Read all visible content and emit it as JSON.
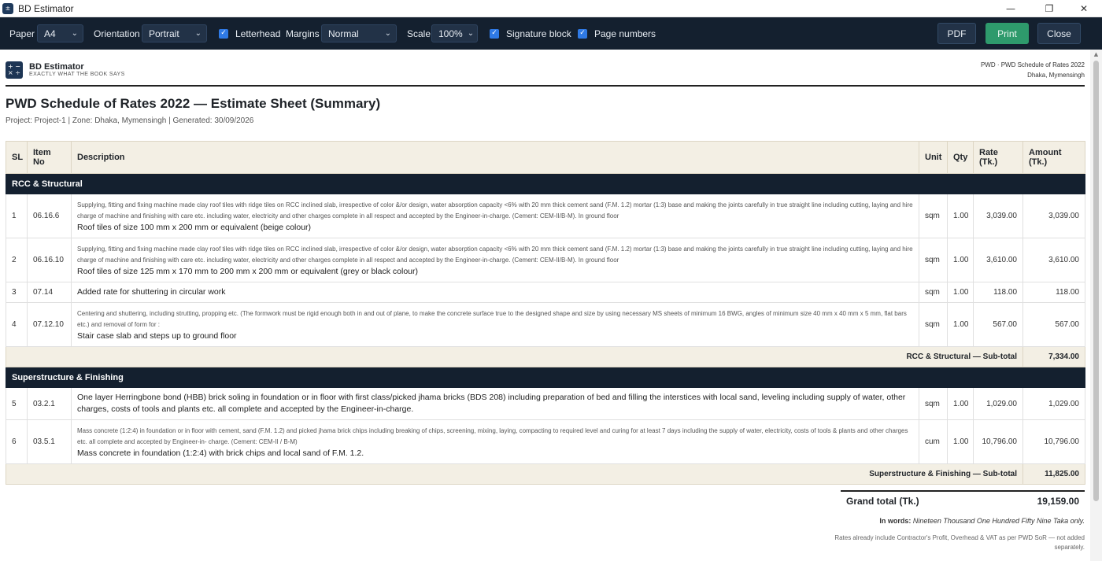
{
  "window": {
    "title": "BD Estimator",
    "controls": {
      "minimize": "—",
      "maximize": "❐",
      "close": "✕"
    }
  },
  "toolbar": {
    "paper_label": "Paper",
    "paper_value": "A4",
    "orientation_label": "Orientation",
    "orientation_value": "Portrait",
    "letterhead_label": "Letterhead",
    "letterhead_checked": true,
    "margins_label": "Margins",
    "margins_value": "Normal",
    "scale_label": "Scale",
    "scale_value": "100%",
    "signature_label": "Signature block",
    "signature_checked": true,
    "page_numbers_label": "Page numbers",
    "page_numbers_checked": true,
    "pdf_label": "PDF",
    "print_label": "Print",
    "close_label": "Close"
  },
  "header": {
    "brand_name": "BD Estimator",
    "brand_tagline": "EXACTLY WHAT THE BOOK SAYS",
    "ref_line": "PWD · PWD Schedule of Rates 2022",
    "zone_line": "Dhaka, Mymensingh",
    "title": "PWD Schedule of Rates 2022 — Estimate Sheet (Summary)",
    "subtitle": "Project: Project-1  |  Zone: Dhaka, Mymensingh  |  Generated: 30/09/2026"
  },
  "table": {
    "columns": {
      "sl": "SL",
      "item_no_1": "Item",
      "item_no_2": "No",
      "description": "Description",
      "unit": "Unit",
      "qty": "Qty",
      "rate_1": "Rate",
      "rate_2": "(Tk.)",
      "amount_1": "Amount",
      "amount_2": "(Tk.)"
    },
    "groups": [
      {
        "name": "RCC & Structural",
        "subtotal_label": "RCC & Structural — Sub-total",
        "subtotal": "7,334.00",
        "rows": [
          {
            "sl": "1",
            "item_no": "06.16.6",
            "spec": "Supplying, fitting and fixing machine made clay roof tiles with ridge tiles on RCC inclined slab, irrespective of color &/or design, water absorption capacity <6% with 20 mm thick cement sand (F.M. 1.2) mortar (1:3) base and making the joints carefully in true straight line including cutting, laying and hire charge of machine and finishing with care etc. including water, electricity and other charges complete in all respect and accepted by the Engineer-in-charge. (Cement: CEM-II/B-M). In ground floor",
            "description": "Roof tiles of size 100 mm x 200 mm or equivalent (beige colour)",
            "unit": "sqm",
            "qty": "1.00",
            "rate": "3,039.00",
            "amount": "3,039.00"
          },
          {
            "sl": "2",
            "item_no": "06.16.10",
            "spec": "Supplying, fitting and fixing machine made clay roof tiles with ridge tiles on RCC inclined slab, irrespective of color &/or design, water absorption capacity <6% with 20 mm thick cement sand (F.M. 1.2) mortar (1:3) base and making the joints carefully in true straight line including cutting, laying and hire charge of machine and finishing with care etc. including water, electricity and other charges complete in all respect and accepted by the Engineer-in-charge. (Cement: CEM-II/B-M). In ground floor",
            "description": "Roof tiles of size 125 mm x 170 mm to 200 mm x 200 mm or equivalent (grey or black colour)",
            "unit": "sqm",
            "qty": "1.00",
            "rate": "3,610.00",
            "amount": "3,610.00"
          },
          {
            "sl": "3",
            "item_no": "07.14",
            "spec": "",
            "description": "Added rate for shuttering in circular work",
            "unit": "sqm",
            "qty": "1.00",
            "rate": "118.00",
            "amount": "118.00"
          },
          {
            "sl": "4",
            "item_no": "07.12.10",
            "spec": "Centering and shuttering, including strutting, propping etc. (The formwork must be rigid enough both in and out of plane, to make the concrete surface true to the designed shape and size by using necessary MS sheets of minimum 16 BWG, angles of minimum size 40 mm x 40 mm x 5 mm, flat bars etc.) and removal of form for :",
            "description": "Stair case slab and steps up to ground floor",
            "unit": "sqm",
            "qty": "1.00",
            "rate": "567.00",
            "amount": "567.00"
          }
        ]
      },
      {
        "name": "Superstructure & Finishing",
        "subtotal_label": "Superstructure & Finishing — Sub-total",
        "subtotal": "11,825.00",
        "rows": [
          {
            "sl": "5",
            "item_no": "03.2.1",
            "spec": "",
            "description": "One layer Herringbone bond (HBB) brick soling in foundation or in floor with first class/picked jhama bricks (BDS 208) including preparation of bed and filling the interstices with local sand, leveling including supply of water, other charges, costs of tools and plants etc. all complete and accepted by the Engineer-in-charge.",
            "unit": "sqm",
            "qty": "1.00",
            "rate": "1,029.00",
            "amount": "1,029.00"
          },
          {
            "sl": "6",
            "item_no": "03.5.1",
            "spec": "Mass concrete (1:2:4) in foundation or in floor with cement, sand (F.M. 1.2) and picked jhama brick chips including breaking of chips, screening, mixing, laying, compacting to required level and curing for at least 7 days including the supply of water, electricity, costs of tools & plants and other charges etc. all complete and accepted by Engineer-in- charge. (Cement: CEM-II / B-M)",
            "description": "Mass concrete in foundation (1:2:4) with brick chips and local sand of F.M. 1.2.",
            "unit": "cum",
            "qty": "1.00",
            "rate": "10,796.00",
            "amount": "10,796.00"
          }
        ]
      }
    ]
  },
  "totals": {
    "grand_total_label": "Grand total (Tk.)",
    "grand_total": "19,159.00",
    "in_words_label": "In words:",
    "in_words": "Nineteen Thousand One Hundred Fifty Nine Taka only.",
    "note": "Rates already include Contractor's Profit, Overhead & VAT as per PWD SoR — not added separately."
  },
  "icons": {
    "app_icon": "calculator-icon",
    "chevron": "chevron-down-icon",
    "checkbox": "checkbox-checked-icon",
    "scroll_up": "scroll-up-arrow-icon"
  },
  "colors": {
    "toolbar_bg": "#14202f",
    "group_header_bg": "#14202f",
    "table_header_bg": "#f3efe4",
    "print_button": "#2e9a6c",
    "checkbox": "#2f7ae5"
  }
}
